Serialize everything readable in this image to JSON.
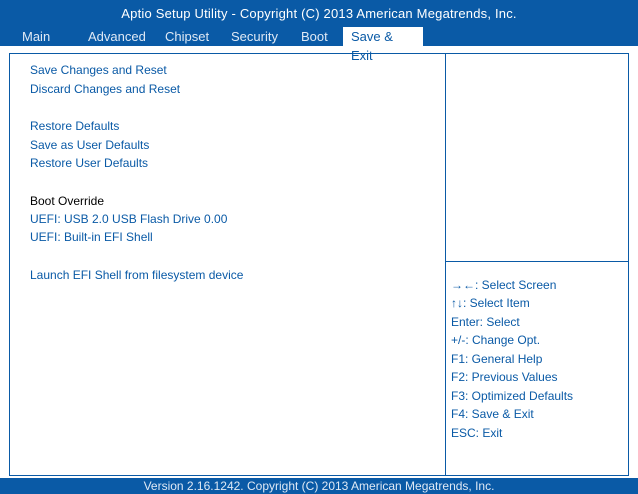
{
  "header": {
    "title": "Aptio Setup Utility - Copyright  (C)  2013 American Megatrends, Inc.",
    "tabs": [
      "Main",
      "Advanced",
      "Chipset",
      "Security",
      "Boot",
      "Save & Exit"
    ],
    "active_tab": "Save & Exit"
  },
  "menu": {
    "save_changes_reset": "Save Changes and Reset",
    "discard_changes_reset": "Discard Changes and Reset",
    "restore_defaults": "Restore Defaults",
    "save_user_defaults": "Save as User Defaults",
    "restore_user_defaults": "Restore User Defaults",
    "boot_override_label": "Boot Override",
    "boot_usb": "UEFI: USB 2.0 USB Flash Drive 0.00",
    "boot_efi_shell": "UEFI: Built-in EFI Shell",
    "launch_efi_shell": "Launch EFI Shell from filesystem device"
  },
  "help": {
    "select_screen": "→←: Select Screen",
    "select_item": "↑↓: Select Item",
    "enter_select": "Enter: Select",
    "change_opt": "+/-: Change Opt.",
    "general_help": "F1: General Help",
    "previous_values": "F2: Previous Values",
    "optimized_defaults": "F3: Optimized Defaults",
    "save_exit": "F4: Save & Exit",
    "esc_exit": "ESC: Exit"
  },
  "footer": {
    "version": "Version 2.16.1242. Copyright  (C)  2013 American Megatrends, Inc."
  },
  "colors": {
    "accent": "#0a5aa6",
    "background": "#ffffff"
  }
}
